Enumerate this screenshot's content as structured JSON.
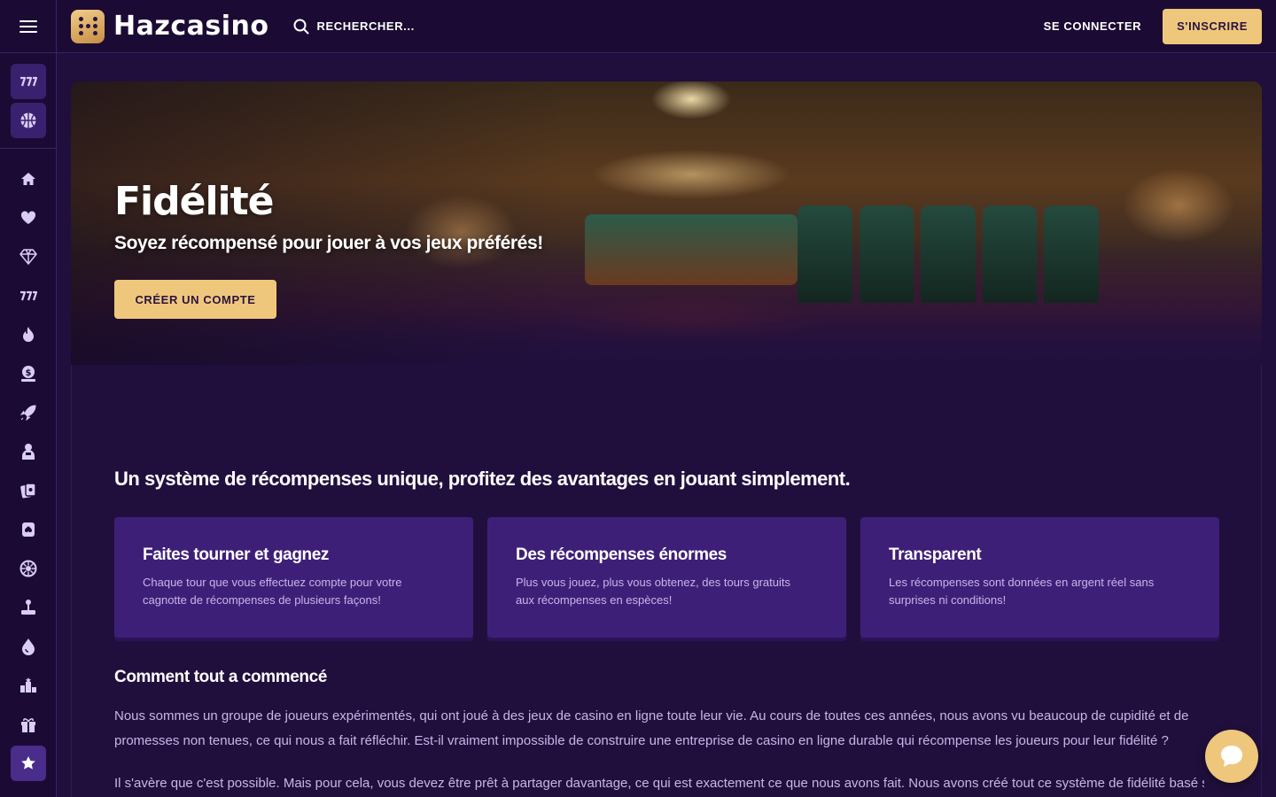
{
  "header": {
    "brand": "Hazcasino",
    "search_label": "RECHERCHER...",
    "login_label": "SE CONNECTER",
    "signup_label": "S'INSCRIRE"
  },
  "sidebar": {
    "top_tiles": [
      {
        "icon": "slot-machine-icon"
      },
      {
        "icon": "basketball-icon"
      }
    ],
    "items": [
      {
        "icon": "home-icon"
      },
      {
        "icon": "heart-icon"
      },
      {
        "icon": "diamond-icon"
      },
      {
        "icon": "slot-machine-icon"
      },
      {
        "icon": "flame-icon"
      },
      {
        "icon": "jackpot-icon"
      },
      {
        "icon": "rocket-icon"
      },
      {
        "icon": "live-dealer-icon"
      },
      {
        "icon": "blackjack-icon"
      },
      {
        "icon": "poker-icon"
      },
      {
        "icon": "roulette-icon"
      },
      {
        "icon": "joystick-icon"
      },
      {
        "icon": "drop-icon"
      },
      {
        "icon": "leaderboard-icon"
      },
      {
        "icon": "gift-icon"
      },
      {
        "icon": "star-icon",
        "active": true
      }
    ]
  },
  "hero": {
    "title": "Fidélité",
    "subtitle": "Soyez récompensé pour jouer à vos jeux préférés!",
    "cta_label": "CRÉER UN COMPTE"
  },
  "rewards": {
    "section_title": "Un système de récompenses unique, profitez des avantages en jouant simplement.",
    "cards": [
      {
        "title": "Faites tourner et gagnez",
        "text": "Chaque tour que vous effectuez compte pour votre cagnotte de récompenses de plusieurs façons!"
      },
      {
        "title": "Des récompenses énormes",
        "text": "Plus vous jouez, plus vous obtenez, des tours gratuits aux récompenses en espèces!"
      },
      {
        "title": "Transparent",
        "text": "Les récompenses sont données en argent réel sans surprises ni conditions!"
      }
    ]
  },
  "story": {
    "title": "Comment tout a commencé",
    "p1": "Nous sommes un groupe de joueurs expérimentés, qui ont joué à des jeux de casino en ligne toute leur vie. Au cours de toutes ces années, nous avons vu beaucoup de cupidité et de promesses non tenues, ce qui nous a fait réfléchir. Est-il vraiment impossible de construire une entreprise de casino en ligne durable qui récompense les joueurs pour leur fidélité ?",
    "p2": "Il s'avère que c'est possible. Mais pour cela, vous devez être prêt à partager davantage, ce qui est exactement ce que nous avons fait. Nous avons créé tout ce système de fidélité basé sur"
  },
  "colors": {
    "background": "#200f3d",
    "rail": "#1b0b34",
    "card": "#3e1f78",
    "accent_gold": "#efc77c",
    "muted_text": "#c6b6e8"
  }
}
